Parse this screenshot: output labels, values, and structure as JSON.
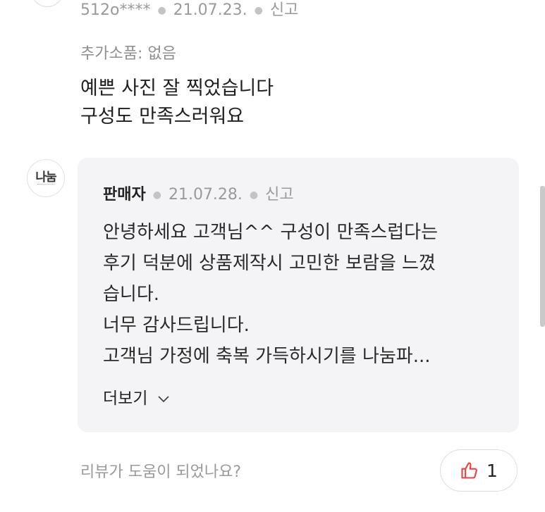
{
  "review": {
    "author": "512o****",
    "date": "21.07.23.",
    "report_label": "신고",
    "option_line": "추가소품: 없음",
    "body_lines": [
      "예쁜 사진 잘 찍었습니다",
      "구성도 만족스러워요"
    ]
  },
  "seller_reply": {
    "avatar_text": "나눔",
    "name": "판매자",
    "date": "21.07.28.",
    "report_label": "신고",
    "body_lines": [
      "안녕하세요 고객님^^ 구성이 만족스럽다는",
      "후기 덕분에 상품제작시 고민한 보람을 느꼈",
      "습니다.",
      "너무 감사드립니다.",
      "고객님 가정에 축복 가득하시기를 나눔파..."
    ],
    "more_label": "더보기"
  },
  "helpful": {
    "question": "리뷰가 도움이 되었나요?",
    "count": "1"
  },
  "colors": {
    "accent_red": "#e8423a",
    "reply_bg": "#f4f4f6",
    "meta_gray": "#9a9a9a"
  },
  "icons": [
    "thumbs-up-icon",
    "chevron-down-icon",
    "dot-separator-icon"
  ]
}
